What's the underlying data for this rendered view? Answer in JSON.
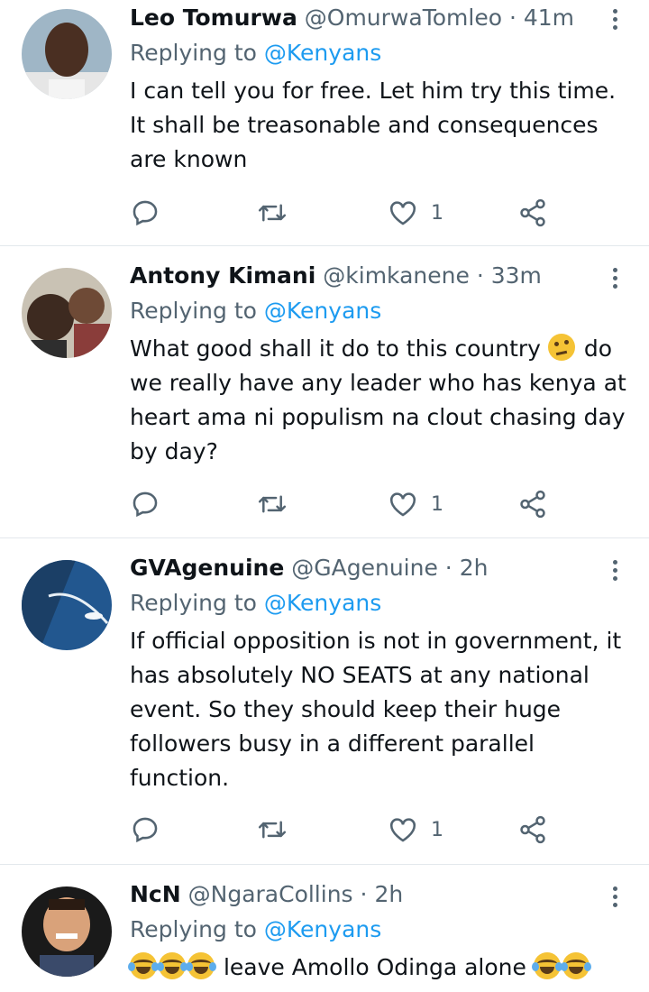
{
  "tweets": [
    {
      "name": "Leo Tomurwa",
      "handle": "@OmurwaTomleo",
      "dot": "·",
      "time": "41m",
      "replying_prefix": "Replying to",
      "replying_to": "@Kenyans",
      "lines": [
        "I can tell you for free. Let him try this time.",
        "It shall be treasonable and  consequences",
        "are known"
      ],
      "likes": "1"
    },
    {
      "name": "Antony Kimani",
      "handle": "@kimkanene",
      "dot": "·",
      "time": "33m",
      "replying_prefix": "Replying to",
      "replying_to": "@Kenyans",
      "lines": [
        "What good shall it do to this country",
        "do",
        "we really have any leader who has kenya at",
        "heart ama ni populism na clout chasing day",
        "by day?"
      ],
      "likes": "1"
    },
    {
      "name": "GVAgenuine",
      "handle": "@GAgenuine",
      "dot": "·",
      "time": "2h",
      "replying_prefix": "Replying to",
      "replying_to": "@Kenyans",
      "lines": [
        "If official opposition is not in government, it",
        "has absolutely NO SEATS at any national",
        "event. So they should keep their huge",
        "followers busy in a different parallel",
        "function."
      ],
      "likes": "1"
    },
    {
      "name": "NcN",
      "handle": "@NgaraCollins",
      "dot": "·",
      "time": "2h",
      "replying_prefix": "Replying to",
      "replying_to": "@Kenyans",
      "lines": [
        "leave Amollo Odinga alone"
      ]
    }
  ],
  "icons": {
    "reply": "reply-icon",
    "retweet": "retweet-icon",
    "like": "heart-icon",
    "share": "share-icon",
    "more": "more-icon",
    "thinking_emoji": "thinking-face-emoji",
    "joy_emoji": "tears-of-joy-emoji"
  },
  "colors": {
    "link": "#1d9bf0",
    "secondary_text": "#536471",
    "primary_text": "#0f1419",
    "divider": "#e3e8ec"
  }
}
